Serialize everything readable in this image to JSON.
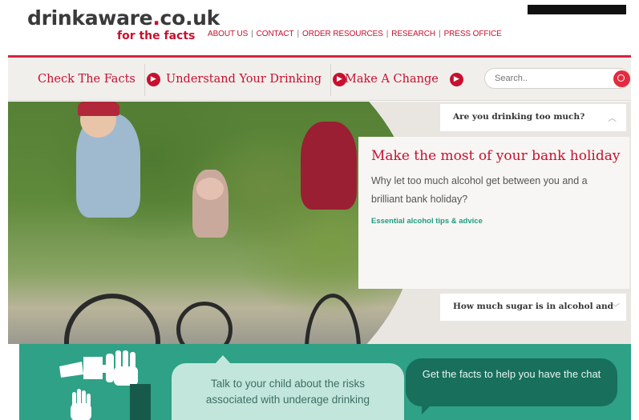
{
  "header": {
    "logo_main": "drinkaware",
    "logo_dot": ".",
    "logo_domain": "co.uk",
    "logo_tagline": "for the facts",
    "links": [
      "ABOUT US",
      "CONTACT",
      "ORDER RESOURCES",
      "RESEARCH",
      "PRESS OFFICE"
    ]
  },
  "nav": {
    "items": [
      {
        "label": "Check The Facts"
      },
      {
        "label": "Understand Your Drinking"
      },
      {
        "label": "Make A Change"
      }
    ],
    "search_placeholder": "Search.."
  },
  "hero": {
    "accordion_top": "Are you drinking too much?",
    "accordion_bottom": "How much sugar is in alcohol and",
    "promo_title": "Make the most of your bank holiday",
    "promo_text": "Why let too much alcohol get between you and a brilliant bank holiday?",
    "promo_link": "Essential alcohol tips & advice"
  },
  "band": {
    "left_bubble": "Talk to your child about the risks associated with underage drinking",
    "right_bubble": "Get the facts to help you have the chat"
  },
  "colors": {
    "brand_red": "#c8102e",
    "teal": "#2ea186",
    "dark_teal": "#176f5c"
  },
  "icons": [
    "arrow-right-icon",
    "search-icon",
    "chevron-up-icon",
    "chevron-down-icon",
    "hand-stop-icon",
    "bottle-icon"
  ]
}
